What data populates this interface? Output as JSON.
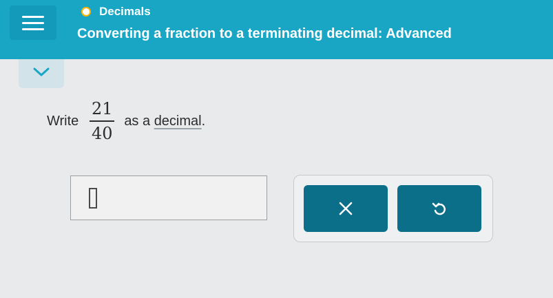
{
  "header": {
    "topic": "Decimals",
    "title": "Converting a fraction to a terminating decimal: Advanced",
    "background_color": "#19a6c5",
    "topic_dot_color": "#ffb200"
  },
  "question": {
    "prefix": "Write",
    "numerator": "21",
    "denominator": "40",
    "suffix_connector": "as a",
    "glossary_term": "decimal",
    "end_punctuation": "."
  },
  "answer": {
    "value": ""
  },
  "controls": {
    "clear_icon": "x-icon",
    "undo_icon": "undo-icon",
    "button_color": "#0c6f8a"
  },
  "icons": {
    "menu": "hamburger-menu-icon",
    "collapse": "chevron-down-icon",
    "cursor": "text-cursor-icon"
  }
}
